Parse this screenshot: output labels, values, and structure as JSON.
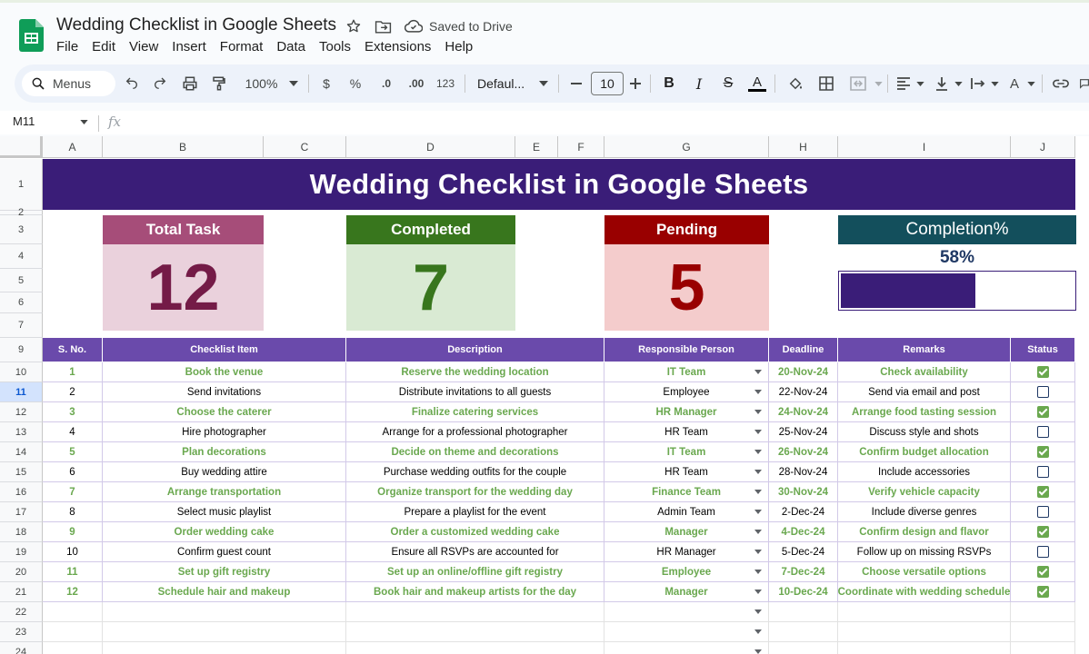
{
  "app": {
    "title": "Wedding Checklist in Google Sheets",
    "saved_status": "Saved to Drive",
    "menu": [
      "File",
      "Edit",
      "View",
      "Insert",
      "Format",
      "Data",
      "Tools",
      "Extensions",
      "Help"
    ]
  },
  "toolbar": {
    "search_label": "Menus",
    "zoom": "100%",
    "currency": "$",
    "percent": "%",
    "decrease_decimal": ".0",
    "increase_decimal": ".00",
    "number_format": "123",
    "font": "Defaul...",
    "font_size": "10"
  },
  "formula_bar": {
    "cell_ref": "M11",
    "fx": "fx"
  },
  "sheet": {
    "columns": [
      "A",
      "B",
      "C",
      "D",
      "E",
      "F",
      "G",
      "H",
      "I",
      "J"
    ],
    "rows": [
      "1",
      "2",
      "3",
      "4",
      "5",
      "6",
      "7",
      "9",
      "10",
      "11",
      "12",
      "13",
      "14",
      "15",
      "16",
      "17",
      "18",
      "19",
      "20",
      "21",
      "22",
      "23",
      "24"
    ],
    "selected_row": "11",
    "banner": "Wedding Checklist in Google Sheets",
    "cards": {
      "total": {
        "label": "Total Task",
        "value": "12"
      },
      "completed": {
        "label": "Completed",
        "value": "7"
      },
      "pending": {
        "label": "Pending",
        "value": "5"
      },
      "completion": {
        "label": "Completion%",
        "value": "58%",
        "fraction": 0.58
      }
    },
    "headers": [
      "S. No.",
      "Checklist Item",
      "Description",
      "Responsible Person",
      "Deadline",
      "Remarks",
      "Status"
    ],
    "tasks": [
      {
        "no": "1",
        "item": "Book the venue",
        "desc": "Reserve the wedding location",
        "person": "IT Team",
        "deadline": "20-Nov-24",
        "remarks": "Check availability",
        "done": true
      },
      {
        "no": "2",
        "item": "Send invitations",
        "desc": "Distribute invitations to all guests",
        "person": "Employee",
        "deadline": "22-Nov-24",
        "remarks": "Send via email and post",
        "done": false
      },
      {
        "no": "3",
        "item": "Choose the caterer",
        "desc": "Finalize catering services",
        "person": "HR Manager",
        "deadline": "24-Nov-24",
        "remarks": "Arrange food tasting session",
        "done": true
      },
      {
        "no": "4",
        "item": "Hire photographer",
        "desc": "Arrange for a professional photographer",
        "person": "HR Team",
        "deadline": "25-Nov-24",
        "remarks": "Discuss style and shots",
        "done": false
      },
      {
        "no": "5",
        "item": "Plan decorations",
        "desc": "Decide on theme and decorations",
        "person": "IT Team",
        "deadline": "26-Nov-24",
        "remarks": "Confirm budget allocation",
        "done": true
      },
      {
        "no": "6",
        "item": "Buy wedding attire",
        "desc": "Purchase wedding outfits for the couple",
        "person": "HR Team",
        "deadline": "28-Nov-24",
        "remarks": "Include accessories",
        "done": false
      },
      {
        "no": "7",
        "item": "Arrange transportation",
        "desc": "Organize transport for the wedding day",
        "person": "Finance Team",
        "deadline": "30-Nov-24",
        "remarks": "Verify vehicle capacity",
        "done": true
      },
      {
        "no": "8",
        "item": "Select music playlist",
        "desc": "Prepare a playlist for the event",
        "person": "Admin Team",
        "deadline": "2-Dec-24",
        "remarks": "Include diverse genres",
        "done": false
      },
      {
        "no": "9",
        "item": "Order wedding cake",
        "desc": "Order a customized wedding cake",
        "person": "Manager",
        "deadline": "4-Dec-24",
        "remarks": "Confirm design and flavor",
        "done": true
      },
      {
        "no": "10",
        "item": "Confirm guest count",
        "desc": "Ensure all RSVPs are accounted for",
        "person": "HR Manager",
        "deadline": "5-Dec-24",
        "remarks": "Follow up on missing RSVPs",
        "done": false
      },
      {
        "no": "11",
        "item": "Set up gift registry",
        "desc": "Set up an online/offline gift registry",
        "person": "Employee",
        "deadline": "7-Dec-24",
        "remarks": "Choose versatile options",
        "done": true
      },
      {
        "no": "12",
        "item": "Schedule hair and makeup",
        "desc": "Book hair and makeup artists for the day",
        "person": "Manager",
        "deadline": "10-Dec-24",
        "remarks": "Coordinate with wedding schedule",
        "done": true
      }
    ]
  },
  "colors": {
    "banner": "#3a1d78",
    "total_head": "#a64d79",
    "total_body": "#ead1dc",
    "total_text": "#741b47",
    "completed_head": "#38761d",
    "completed_body": "#d9ead3",
    "completed_text": "#38761d",
    "pending_head": "#990000",
    "pending_body": "#f4cccc",
    "pending_text": "#990000",
    "completion_head": "#134f5c",
    "table_header": "#6a4aab",
    "done_text": "#6aa84f"
  }
}
